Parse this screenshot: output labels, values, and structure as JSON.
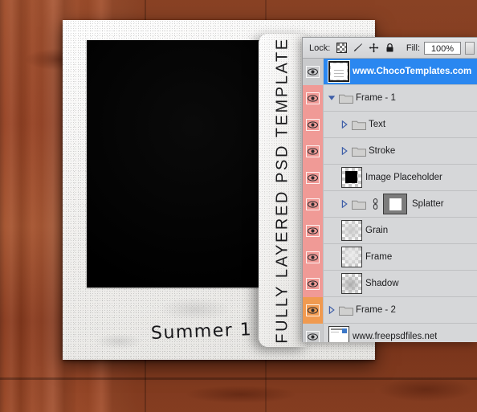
{
  "background": {
    "material": "wood-planks",
    "color": "#a34a27"
  },
  "polaroid": {
    "caption": "Summer 1",
    "photo_color": "#000000",
    "paper_color": "#efeeec"
  },
  "tab": {
    "text": "FULLY LAYERED PSD TEMPLATE"
  },
  "panel": {
    "toolbar": {
      "lock_label": "Lock:",
      "lock_icons": [
        "transparency-lock-icon",
        "paint-lock-icon",
        "position-lock-icon",
        "lock-all-icon"
      ],
      "fill_label": "Fill:",
      "fill_value": "100%"
    },
    "selection_color": "#2a87f0",
    "layers": [
      {
        "name": "www.ChocoTemplates.com",
        "eye": "visible",
        "eye_bg": "gray",
        "selected": true,
        "indent": 0,
        "type": "image",
        "thumb": "note",
        "disclosure": "none"
      },
      {
        "name": "Frame - 1",
        "eye": "visible",
        "eye_bg": "pink",
        "selected": false,
        "indent": 0,
        "type": "group",
        "thumb": "folder",
        "disclosure": "expanded"
      },
      {
        "name": "Text",
        "eye": "visible",
        "eye_bg": "pink",
        "selected": false,
        "indent": 1,
        "type": "group",
        "thumb": "folder",
        "disclosure": "collapsed"
      },
      {
        "name": "Stroke",
        "eye": "visible",
        "eye_bg": "pink",
        "selected": false,
        "indent": 1,
        "type": "group",
        "thumb": "folder",
        "disclosure": "collapsed"
      },
      {
        "name": "Image Placeholder",
        "eye": "visible",
        "eye_bg": "pink",
        "selected": false,
        "indent": 1,
        "type": "image",
        "thumb": "black-square",
        "disclosure": "none"
      },
      {
        "name": "Splatter",
        "eye": "visible",
        "eye_bg": "pink",
        "selected": false,
        "indent": 1,
        "type": "group-masked",
        "thumb": "folder",
        "disclosure": "collapsed",
        "has_link": true,
        "has_mask": true
      },
      {
        "name": "Grain",
        "eye": "visible",
        "eye_bg": "pink",
        "selected": false,
        "indent": 1,
        "type": "image",
        "thumb": "soft-cloud",
        "disclosure": "none"
      },
      {
        "name": "Frame",
        "eye": "visible",
        "eye_bg": "pink",
        "selected": false,
        "indent": 1,
        "type": "image",
        "thumb": "frame-glow",
        "disclosure": "none"
      },
      {
        "name": "Shadow",
        "eye": "visible",
        "eye_bg": "pink",
        "selected": false,
        "indent": 1,
        "type": "image",
        "thumb": "soft-shadow",
        "disclosure": "none"
      },
      {
        "name": "Frame - 2",
        "eye": "visible",
        "eye_bg": "orange",
        "selected": false,
        "indent": 0,
        "type": "group",
        "thumb": "folder",
        "disclosure": "collapsed"
      },
      {
        "name": "www.freepsdfiles.net",
        "eye": "visible",
        "eye_bg": "gray",
        "selected": false,
        "indent": 0,
        "type": "image",
        "thumb": "webpage",
        "disclosure": "none"
      }
    ]
  }
}
